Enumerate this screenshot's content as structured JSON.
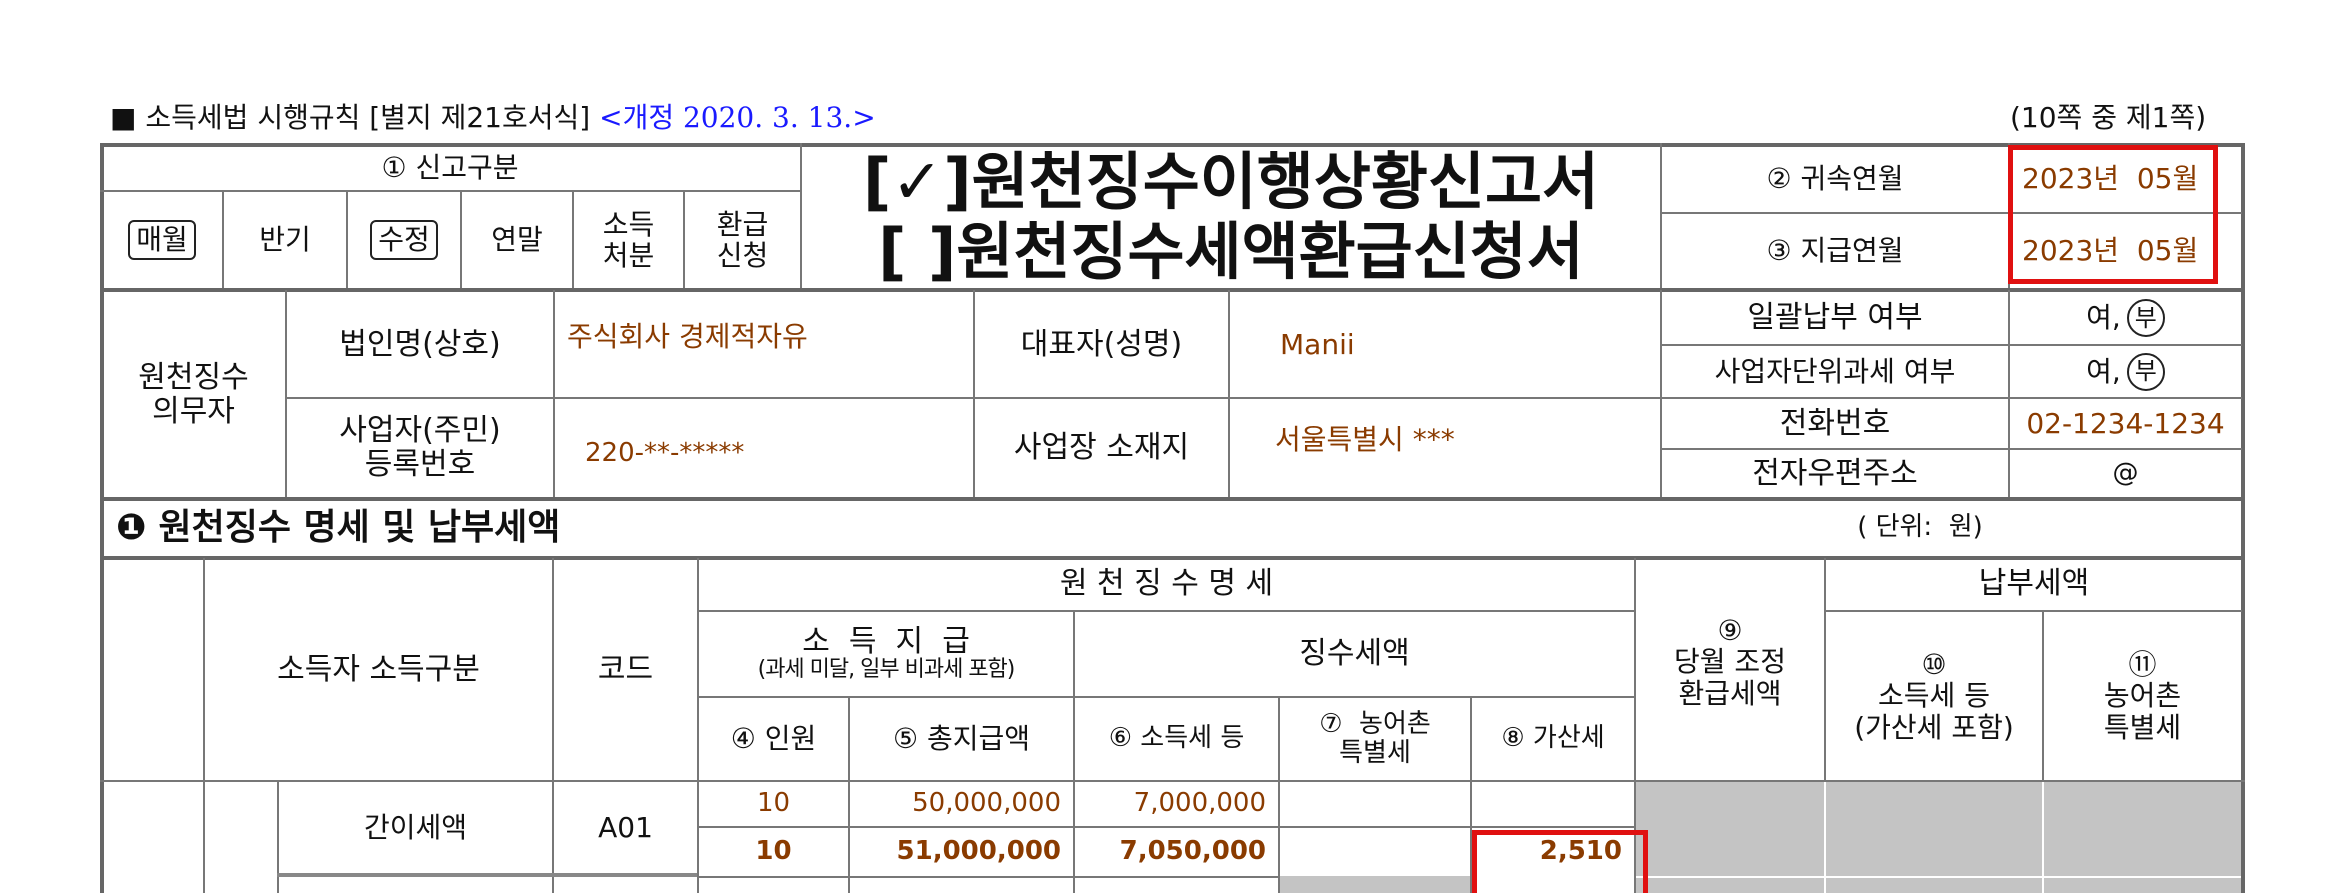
{
  "header": {
    "square": "■",
    "law": "소득세법 시행규칙 [별지 제21호서식]",
    "revision": "<개정 2020. 3. 13.>",
    "page": "(10쪽 중 제1쪽)"
  },
  "filing": {
    "type_label": "① 신고구분",
    "opt_monthly": "매월",
    "opt_half": "반기",
    "opt_amend": "수정",
    "opt_yearend": "연말",
    "opt_disposal": "소득\n처분",
    "opt_refund": "환급\n신청",
    "title1": "[✓]원천징수이행상황신고서",
    "title2": "[ ]원천징수세액환급신청서",
    "belong_label": "② 귀속연월",
    "belong_value": "2023년  05월",
    "pay_label": "③ 지급연월",
    "pay_value": "2023년  05월"
  },
  "agent": {
    "section_label": "원천징수\n의무자",
    "corp_label": "법인명(상호)",
    "corp_value": "주식회사 경제적자유",
    "rep_label": "대표자(성명)",
    "rep_value": "Manii",
    "bizno_label": "사업자(주민)\n등록번호",
    "bizno_value": "220-**-*****",
    "addr_label": "사업장 소재지",
    "addr_value": "서울특별시 ***",
    "bulk_label": "일괄납부 여부",
    "bulk_value_yes": "여,",
    "bulk_value_no": "부",
    "unit_tax_label": "사업자단위과세 여부",
    "unit_tax_yes": "여,",
    "unit_tax_no": "부",
    "phone_label": "전화번호",
    "phone_value": "02-1234-1234",
    "email_label": "전자우편주소",
    "email_value": "@"
  },
  "section1": {
    "bullet": "❶",
    "title": "원천징수 명세 및 납부세액",
    "unit": "( 단위:  원)",
    "hdr_detail": "원 천 징 수 명 세",
    "hdr_pay_tax": "납부세액",
    "hdr_income_class": "소득자 소득구분",
    "hdr_code": "코드",
    "hdr_payment": "소  득  지  급",
    "hdr_payment_sub": "(과세 미달, 일부 비과세 포함)",
    "hdr_withheld": "징수세액",
    "hdr_adjust": "⑨\n당월 조정\n환급세액",
    "hdr_col10": "⑩\n소득세 등\n(가산세 포함)",
    "hdr_col11": "⑪\n농어촌\n특별세",
    "hdr_col4": "④ 인원",
    "hdr_col5": "⑤ 총지급액",
    "hdr_col6": "⑥ 소득세 등",
    "hdr_col7": "⑦  농어촌\n특별세",
    "hdr_col8": "⑧ 가산세"
  },
  "rows": [
    {
      "name": "간이세액",
      "code": "A01",
      "line1": {
        "count": "10",
        "total": "50,000,000",
        "tax": "7,000,000"
      },
      "line2": {
        "count": "10",
        "total": "51,000,000",
        "tax": "7,050,000",
        "penalty": "2,510"
      }
    }
  ],
  "colors": {
    "accent_blue": "#1a1aff",
    "value_brown": "#8a3b00",
    "highlight_red": "#e01010"
  }
}
